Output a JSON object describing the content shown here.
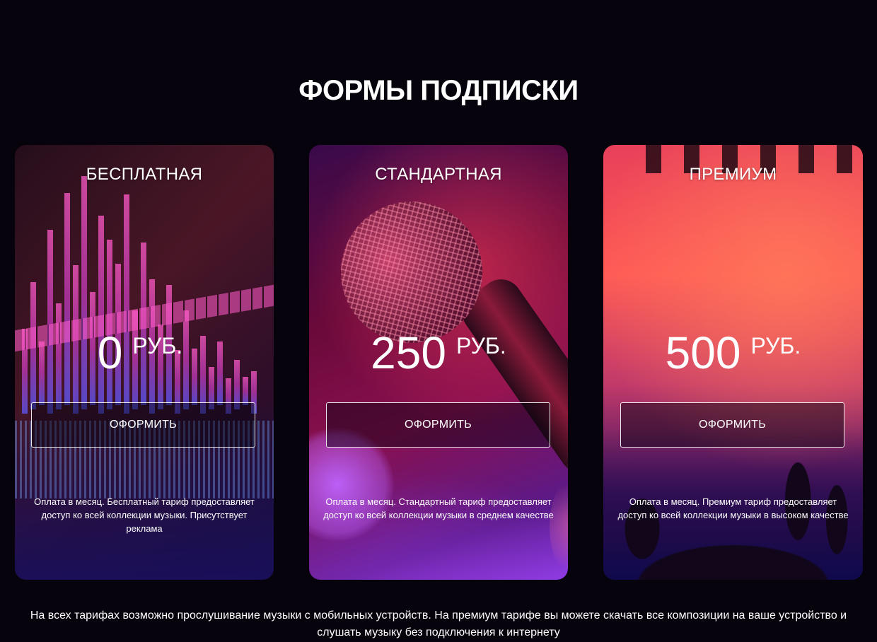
{
  "section": {
    "title": "ФОРМЫ ПОДПИСКИ"
  },
  "plans": [
    {
      "name": "БЕСПЛАТНАЯ",
      "price": "0",
      "currency": "РУБ.",
      "button_label": "ОФОРМИТЬ",
      "description": "Оплата в месяц. Бесплатный тариф предоставляет доступ ко всей коллекции музыки. Присутствует реклама",
      "image": "audio-equalizer"
    },
    {
      "name": "СТАНДАРТНАЯ",
      "price": "250",
      "currency": "РУБ.",
      "button_label": "ОФОРМИТЬ",
      "description": "Оплата в месяц. Стандартный тариф предоставляет доступ ко всей коллекции музыки в среднем качестве",
      "image": "microphone"
    },
    {
      "name": "ПРЕМИУМ",
      "price": "500",
      "currency": "РУБ.",
      "button_label": "ОФОРМИТЬ",
      "description": "Оплата в месяц. Премиум тариф предоставляет доступ ко всей коллекции музыки в высоком качестве",
      "image": "concert-crowd"
    }
  ],
  "footer": {
    "note": "На всех тарифах возможно прослушивание музыки с мобильных устройств. На премиум тарифе вы можете скачать все композиции на ваше устройство и слушать музыку без подключения к интернету"
  },
  "colors": {
    "background": "#07030d",
    "text": "#ffffff"
  }
}
